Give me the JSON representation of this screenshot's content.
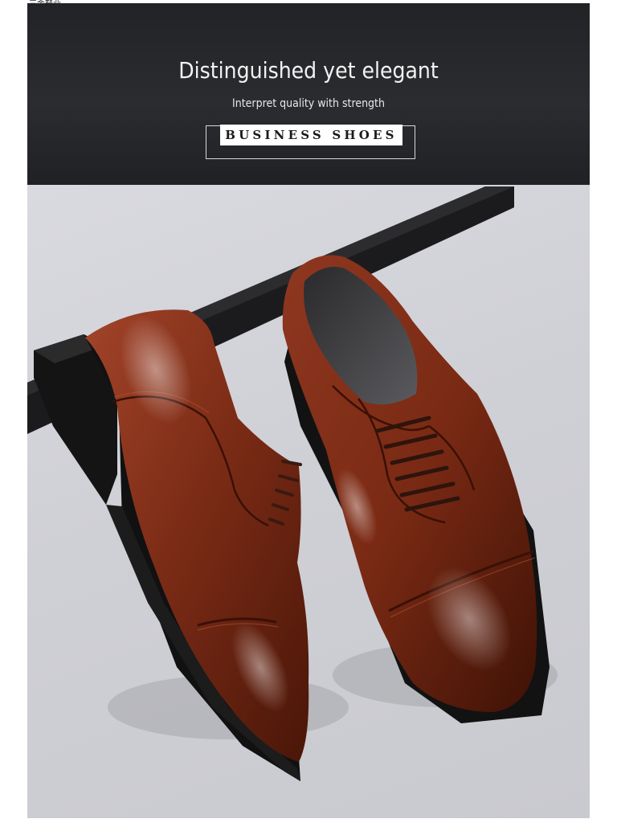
{
  "watermark": "三金鞋业",
  "banner": {
    "headline": "Distinguished yet elegant",
    "subline": "Interpret quality with strength",
    "badge": "BUSINESS SHOES"
  },
  "photo": {
    "subject": "brown-oxford-shoes",
    "colors": {
      "leather": "#7a2a14",
      "sole": "#151515",
      "background": "#d2d3d9"
    }
  }
}
